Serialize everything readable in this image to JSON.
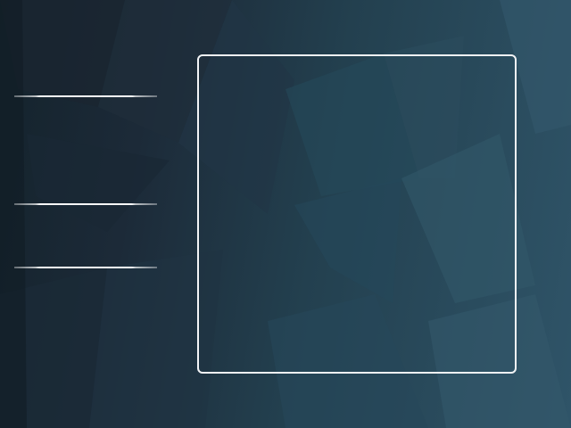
{
  "theme": {
    "background_dark": "#14232c",
    "background_light": "#2f5468",
    "line_color": "#ffffff",
    "panel_border": "#f2f4f6"
  },
  "sidebar": {
    "divider_count": 3
  },
  "panel": {
    "content": ""
  }
}
